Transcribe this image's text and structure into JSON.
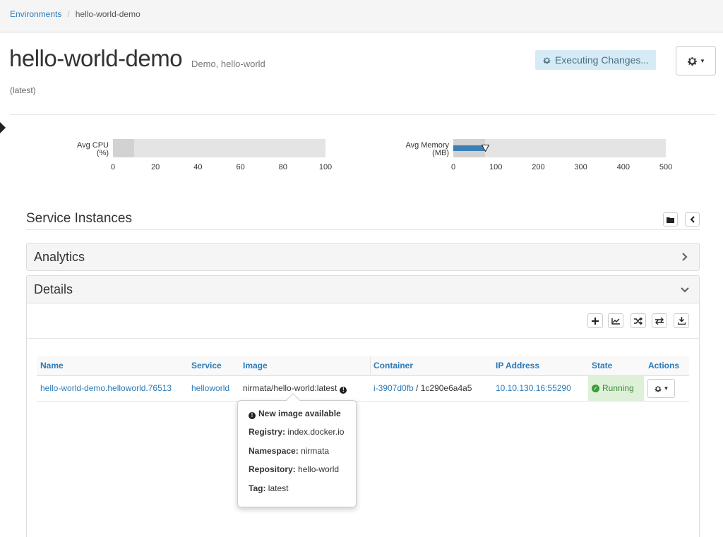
{
  "breadcrumb": {
    "root": "Environments",
    "separator": "/",
    "current": "hello-world-demo"
  },
  "header": {
    "title": "hello-world-demo",
    "subtitle": "Demo, hello-world",
    "version": "(latest)",
    "status_badge": "Executing Changes..."
  },
  "icons": {
    "gear": "gear-icon",
    "caret": "caret-down-icon",
    "folder": "folder-icon",
    "chevron_left": "chevron-left-icon",
    "chevron_right": "chevron-right-icon",
    "chevron_down": "chevron-down-icon",
    "plus": "plus-icon",
    "chart": "line-chart-icon",
    "shuffle": "shuffle-icon",
    "exchange": "exchange-icon",
    "download": "download-icon",
    "info": "info-icon",
    "check": "check-circle-icon"
  },
  "metrics": {
    "cpu": {
      "label_line1": "Avg CPU",
      "label_line2": "(%)",
      "ticks": [
        "0",
        "20",
        "40",
        "60",
        "80",
        "100"
      ],
      "max": 100,
      "range_value": 10
    },
    "memory": {
      "label_line1": "Avg Memory",
      "label_line2": "(MB)",
      "ticks": [
        "0",
        "100",
        "200",
        "300",
        "400",
        "500"
      ],
      "max": 500,
      "range_value": 75,
      "value": 73,
      "marker": 75
    }
  },
  "service_instances": {
    "title": "Service Instances"
  },
  "analytics": {
    "title": "Analytics"
  },
  "details": {
    "title": "Details",
    "columns": [
      "Name",
      "Service",
      "Image",
      "Container",
      "IP Address",
      "State",
      "Actions"
    ],
    "row": {
      "name": "hello-world-demo.helloworld.76513",
      "service": "helloworld",
      "image": "nirmata/hello-world:latest",
      "container_id": "i-3907d0fb",
      "container_sep": " / ",
      "container_hash": "1c290e6a4a5",
      "ip": "10.10.130.16:55290",
      "state": "Running"
    }
  },
  "popover": {
    "title": "New image available",
    "registry_label": "Registry:",
    "registry": "index.docker.io",
    "namespace_label": "Namespace:",
    "namespace": "nirmata",
    "repository_label": "Repository:",
    "repository": "hello-world",
    "tag_label": "Tag:",
    "tag": "latest"
  },
  "colors": {
    "link": "#2a7ab8",
    "running_bg": "#dff0d8",
    "running_text": "#3c8a3c",
    "badge_bg": "#d6ebf5",
    "bar_blue": "#3a7fb6"
  }
}
